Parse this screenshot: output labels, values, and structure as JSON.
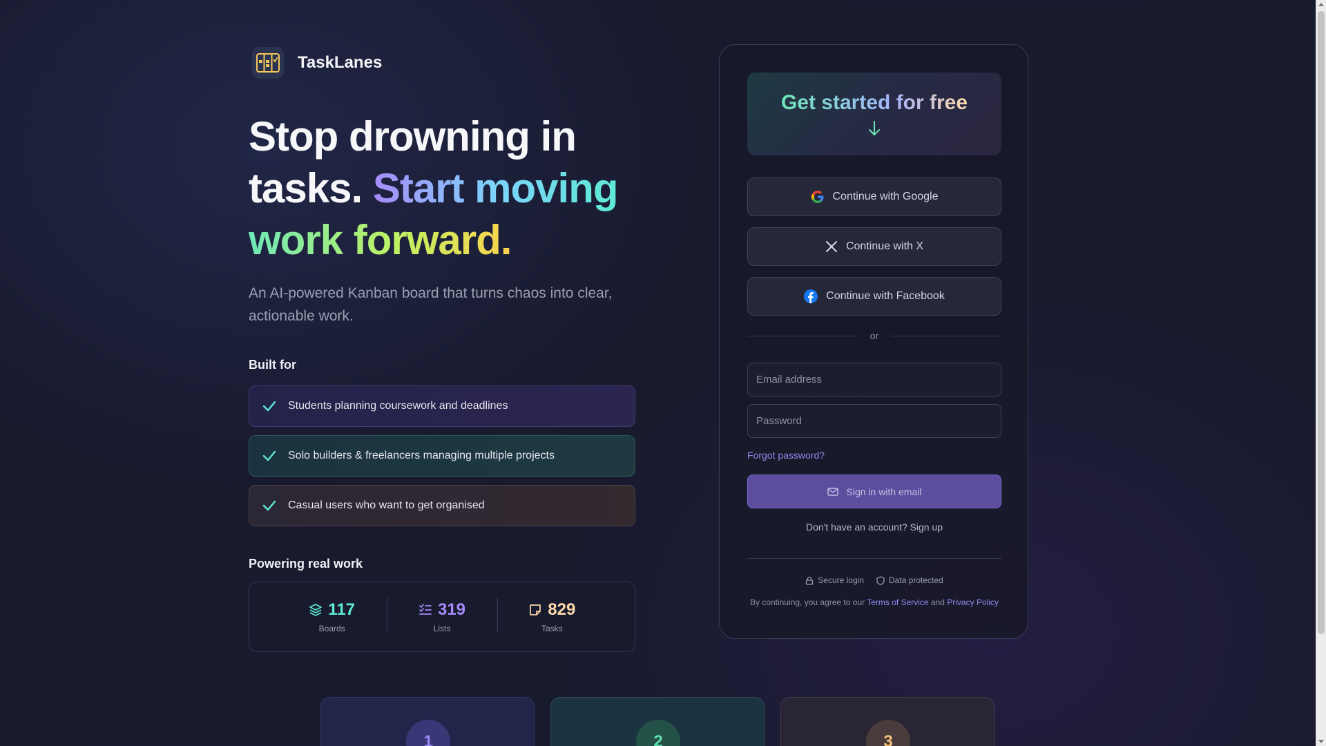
{
  "brand": {
    "name": "TaskLanes",
    "logo_icon": "kanban-board-icon"
  },
  "hero": {
    "line_white_1": "Stop drowning in tasks.",
    "line_grad_1": "Start moving",
    "line_grad_2": "work forward."
  },
  "subtitle": "An AI-powered Kanban board that turns chaos into clear, actionable work.",
  "built_for": {
    "title": "Built for",
    "items": [
      {
        "label": "Students planning coursework and deadlines",
        "accent": "#5eead4"
      },
      {
        "label": "Solo builders & freelancers managing multiple projects",
        "accent": "#5eead4"
      },
      {
        "label": "Casual users who want to get organised",
        "accent": "#5eead4"
      }
    ]
  },
  "powering": {
    "title": "Powering real work",
    "stats": [
      {
        "value": "117",
        "label": "Boards",
        "icon": "layers-icon",
        "color": "#5eead4"
      },
      {
        "value": "319",
        "label": "Lists",
        "icon": "list-checks-icon",
        "color": "#a78bfa"
      },
      {
        "value": "829",
        "label": "Tasks",
        "icon": "sticky-note-icon",
        "color": "#fcd9a8"
      }
    ]
  },
  "auth": {
    "cta_title": "Get started for free",
    "google_label": "Continue with Google",
    "x_label": "Continue with X",
    "facebook_label": "Continue with Facebook",
    "divider": "or",
    "email_placeholder": "Email address",
    "password_placeholder": "Password",
    "forgot": "Forgot password?",
    "signin_label": "Sign in with email",
    "signup_text": "Don't have an account? Sign up",
    "trust_secure": "Secure login",
    "trust_data": "Data protected",
    "legal_prefix": "By continuing, you agree to our",
    "terms": "Terms of Service",
    "legal_and": "and",
    "privacy": "Privacy Policy"
  },
  "steps": [
    {
      "num": "1"
    },
    {
      "num": "2"
    },
    {
      "num": "3"
    }
  ],
  "colors": {
    "accent_purple": "#8b8cf0",
    "accent_teal": "#5eead4",
    "signin_bg": "#5c4d9e"
  }
}
